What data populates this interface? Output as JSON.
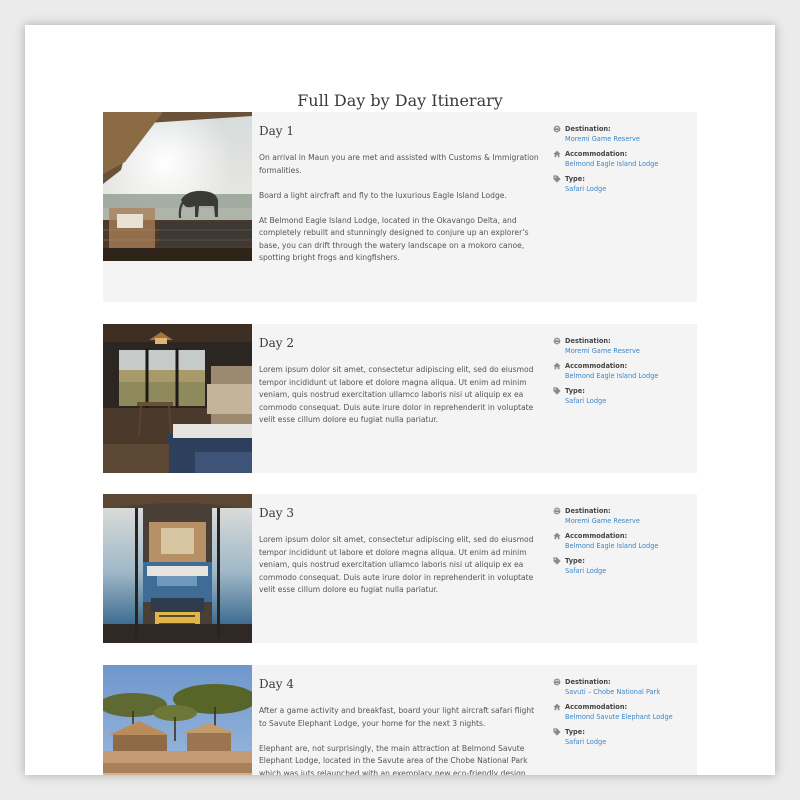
{
  "page": {
    "title": "Full Day by Day Itinerary"
  },
  "labels": {
    "destination": "Destination:",
    "accommodation": "Accommodation:",
    "type": "Type:"
  },
  "days": [
    {
      "title": "Day 1",
      "paragraphs": [
        "On arrival in Maun you are met and assisted with Customs &  Immigration formalities.",
        "Board a light aircfraft  and fly to the luxurious Eagle Island Lodge.",
        "At Belmond Eagle Island Lodge, located in the Okavango Delta, and completely rebuilt and stunningly designed to conjure up an explorer’s base, you can drift through the watery landscape on a mokoro canoe, spotting bright frogs and kingfishers."
      ],
      "destination": "Moremi Game Reserve",
      "accommodation": "Belmond Eagle Island Lodge",
      "type": "Safari Lodge",
      "image_icon": "deck-elephant-photo"
    },
    {
      "title": "Day 2",
      "paragraphs": [
        "Lorem ipsum dolor sit amet, consectetur adipiscing elit, sed do eiusmod tempor incididunt ut labore et dolore magna aliqua. Ut enim ad minim veniam, quis nostrud exercitation ullamco laboris nisi ut aliquip ex ea commodo consequat. Duis aute irure dolor in reprehenderit in voluptate velit esse cillum dolore eu fugiat nulla pariatur."
      ],
      "destination": "Moremi Game Reserve",
      "accommodation": "Belmond Eagle Island Lodge",
      "type": "Safari Lodge",
      "image_icon": "lodge-room-photo"
    },
    {
      "title": "Day 3",
      "paragraphs": [
        "Lorem ipsum dolor sit amet, consectetur adipiscing elit, sed do eiusmod tempor incididunt ut labore et dolore magna aliqua. Ut enim ad minim veniam, quis nostrud exercitation ullamco laboris nisi ut aliquip ex ea commodo consequat. Duis aute irure dolor in reprehenderit in voluptate velit esse cillum dolore eu fugiat nulla pariatur."
      ],
      "destination": "Moremi Game Reserve",
      "accommodation": "Belmond Eagle Island Lodge",
      "type": "Safari Lodge",
      "image_icon": "canopy-bed-photo"
    },
    {
      "title": "Day 4",
      "paragraphs": [
        "After a game activity and breakfast, board your light aircraft safari flight to Savute Elephant Lodge, your home for the next 3 nights.",
        "Elephant are, not surprisingly, the main attraction at Belmond Savute Elephant Lodge, located in the Savute area of the Chobe National Park which was juts relaunched with an exemplary new eco-friendly design."
      ],
      "destination": "Savuti – Chobe National Park",
      "accommodation": "Belmond Savute Elephant Lodge",
      "type": "Safari Lodge",
      "image_icon": "savute-lodge-photo"
    }
  ]
}
